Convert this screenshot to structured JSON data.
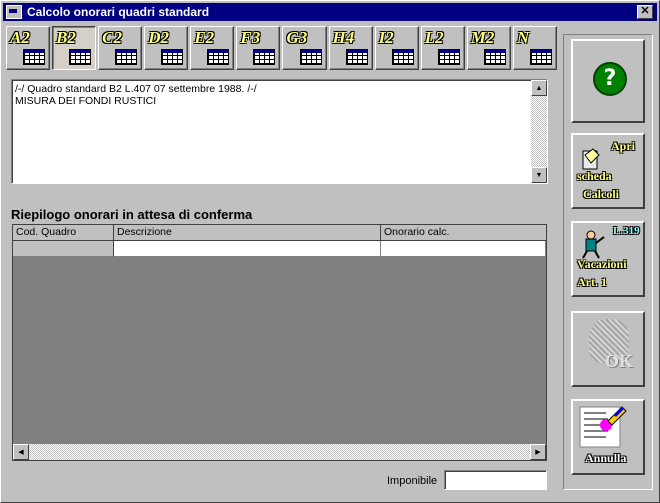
{
  "window": {
    "title": "Calcolo onorari quadri standard",
    "close_glyph": "✕"
  },
  "toolbar": {
    "buttons": [
      {
        "label": "A2"
      },
      {
        "label": "B2"
      },
      {
        "label": "C2"
      },
      {
        "label": "D2"
      },
      {
        "label": "E2"
      },
      {
        "label": "F3"
      },
      {
        "label": "G3"
      },
      {
        "label": "H4"
      },
      {
        "label": "I2"
      },
      {
        "label": "L2"
      },
      {
        "label": "M2"
      },
      {
        "label": "N"
      }
    ],
    "active": "B2"
  },
  "description": {
    "line1": "/-/ Quadro standard B2 L.407 07 settembre 1988. /-/",
    "line2": "MISURA DEI FONDI RUSTICI"
  },
  "summary": {
    "title": "Riepilogo onorari in attesa di conferma",
    "columns": [
      "Cod. Quadro",
      "Descrizione",
      "Onorario calc."
    ]
  },
  "footer": {
    "imponibile_label": "Imponibile",
    "imponibile_value": ""
  },
  "side": {
    "help_glyph": "?",
    "apri_line1": "Apri",
    "apri_line2": "scheda",
    "apri_line3": "Calcoli",
    "vac_badge": "L.319",
    "vac_line1": "Vacazioni",
    "vac_line2": "Art. 1",
    "ok_label": "OK",
    "annulla_label": "Annulla"
  },
  "colors": {
    "titlebar": "#000080",
    "face": "#c0c0c0",
    "label_yellow": "#ffff80"
  }
}
